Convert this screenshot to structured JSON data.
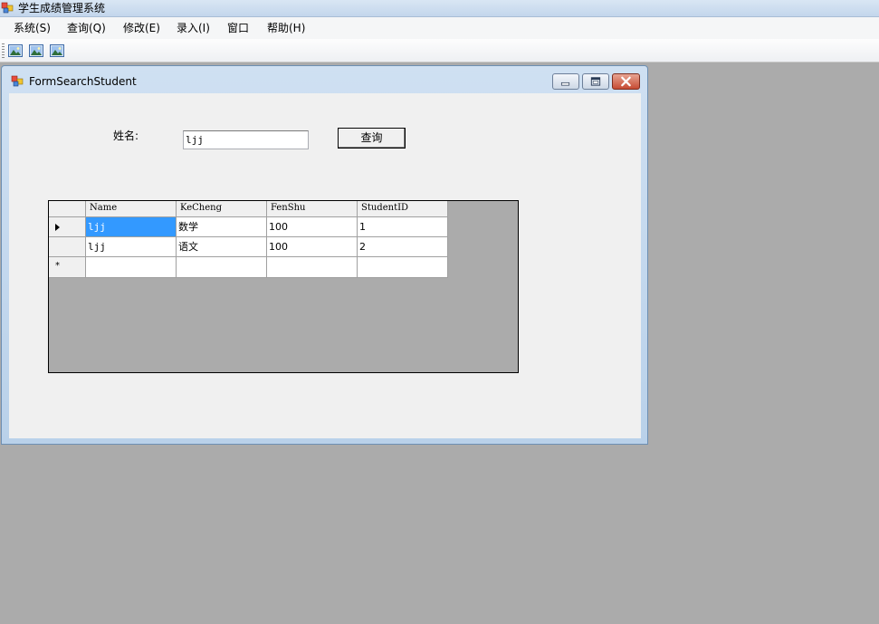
{
  "app": {
    "title": "学生成绩管理系统"
  },
  "menu": {
    "items": [
      "系统(S)",
      "查询(Q)",
      "修改(E)",
      "录入(I)",
      "窗口",
      "帮助(H)"
    ]
  },
  "toolbar": {
    "buttons": [
      "image-icon",
      "image-icon",
      "image-icon"
    ]
  },
  "child_window": {
    "title": "FormSearchStudent",
    "name_label": "姓名:",
    "name_value": "ljj",
    "search_button": "查询"
  },
  "grid": {
    "columns": [
      "Name",
      "KeCheng",
      "FenShu",
      "StudentID"
    ],
    "rows": [
      [
        "ljj",
        "数学",
        "100",
        "1"
      ],
      [
        "ljj",
        "语文",
        "100",
        "2"
      ]
    ],
    "new_row_marker": "*",
    "selected_row": 0
  },
  "colors": {
    "selection": "#3399ff",
    "mdi_background": "#ababab"
  }
}
